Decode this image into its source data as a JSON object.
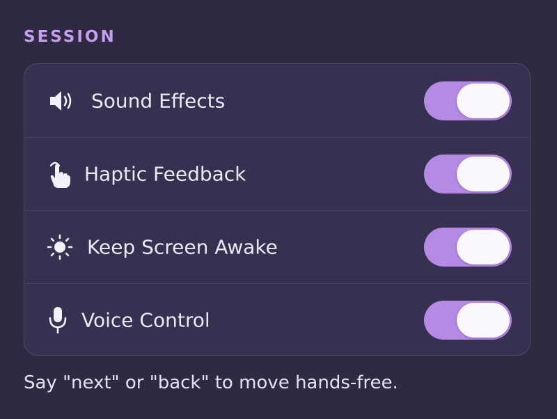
{
  "section": {
    "title": "SESSION"
  },
  "settings": [
    {
      "label": "Sound Effects",
      "icon": "speaker-icon",
      "enabled": true
    },
    {
      "label": "Haptic Feedback",
      "icon": "tap-hand-icon",
      "enabled": true
    },
    {
      "label": "Keep Screen Awake",
      "icon": "sun-icon",
      "enabled": true
    },
    {
      "label": "Voice Control",
      "icon": "microphone-icon",
      "enabled": true
    }
  ],
  "footer": {
    "hint": "Say \"next\" or \"back\" to move hands-free."
  },
  "colors": {
    "background": "#2f2944",
    "card": "#373050",
    "accent": "#c39ff0",
    "toggle_on": "#b48ae6",
    "knob": "#faf8fd"
  }
}
